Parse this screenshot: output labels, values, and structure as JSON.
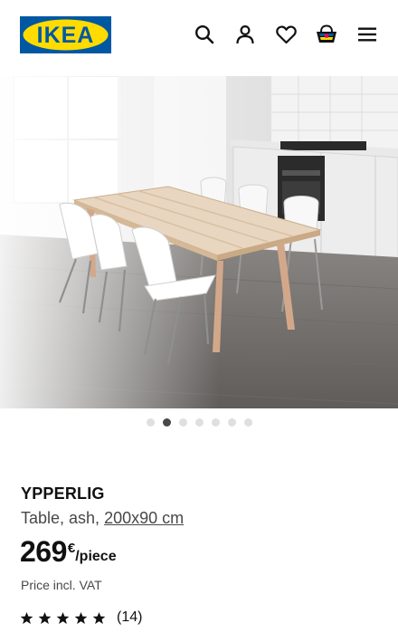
{
  "header": {
    "logo_text": "IKEA",
    "icons": [
      "search-icon",
      "account-icon",
      "heart-icon",
      "basket-icon",
      "menu-icon"
    ],
    "brand_colors": {
      "blue": "#0058a3",
      "yellow": "#ffdb00"
    }
  },
  "gallery": {
    "image_alt": "Table, ash, with white chairs in a kitchen",
    "image_count": 7,
    "active_index": 1
  },
  "product": {
    "name": "YPPERLIG",
    "type": "Table, ash, ",
    "size": "200x90 cm",
    "price": "269",
    "currency": "€",
    "unit": "/piece",
    "vat_note": "Price incl. VAT",
    "rating": {
      "stars": 5,
      "count_label": "(14)"
    }
  }
}
